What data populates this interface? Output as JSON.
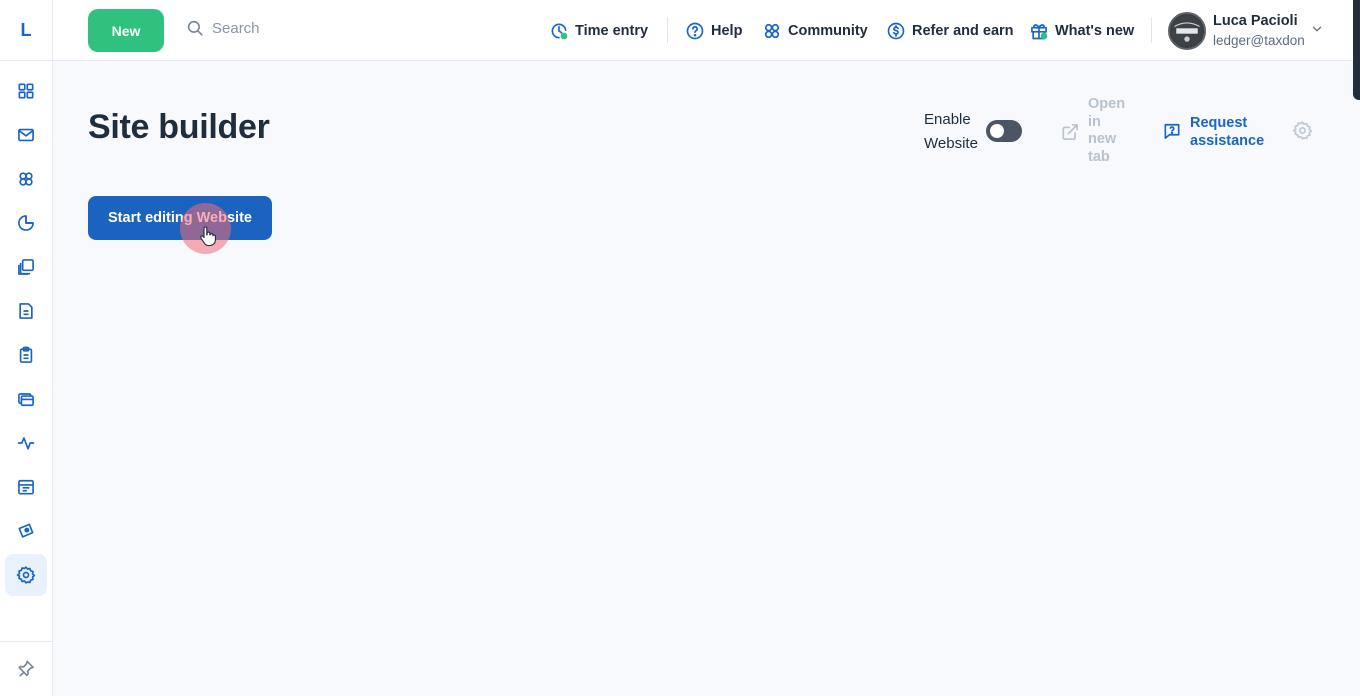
{
  "app": {
    "logo_letter": "L"
  },
  "header": {
    "new_label": "New",
    "search_placeholder": "Search",
    "links": [
      {
        "label": "Time entry",
        "icon": "time-entry-icon"
      },
      {
        "label": "Help",
        "icon": "help-icon"
      },
      {
        "label": "Community",
        "icon": "community-icon"
      },
      {
        "label": "Refer and earn",
        "icon": "dollar-icon"
      },
      {
        "label": "What's new",
        "icon": "gift-icon"
      }
    ],
    "user": {
      "name": "Luca Pacioli",
      "email": "ledger@taxdon"
    }
  },
  "sidebar": {
    "items": [
      {
        "icon": "dashboard-icon"
      },
      {
        "icon": "mail-icon"
      },
      {
        "icon": "contacts-icon"
      },
      {
        "icon": "reports-icon"
      },
      {
        "icon": "documents-icon"
      },
      {
        "icon": "invoice-icon"
      },
      {
        "icon": "clipboard-icon"
      },
      {
        "icon": "billing-icon"
      },
      {
        "icon": "activity-icon"
      },
      {
        "icon": "calendar-icon"
      },
      {
        "icon": "marketing-icon"
      },
      {
        "icon": "settings-icon",
        "active": true
      }
    ],
    "pin_icon": "pin-icon"
  },
  "main": {
    "title": "Site builder",
    "edit_button": "Start editing Website",
    "enable_label": "Enable Website",
    "enable_website": false,
    "open_tab_label": "Open in new tab",
    "request_label": "Request assistance"
  },
  "colors": {
    "accent": "#1c63bf",
    "new_button": "#2ec27e",
    "link_blue": "#1a66c4"
  }
}
